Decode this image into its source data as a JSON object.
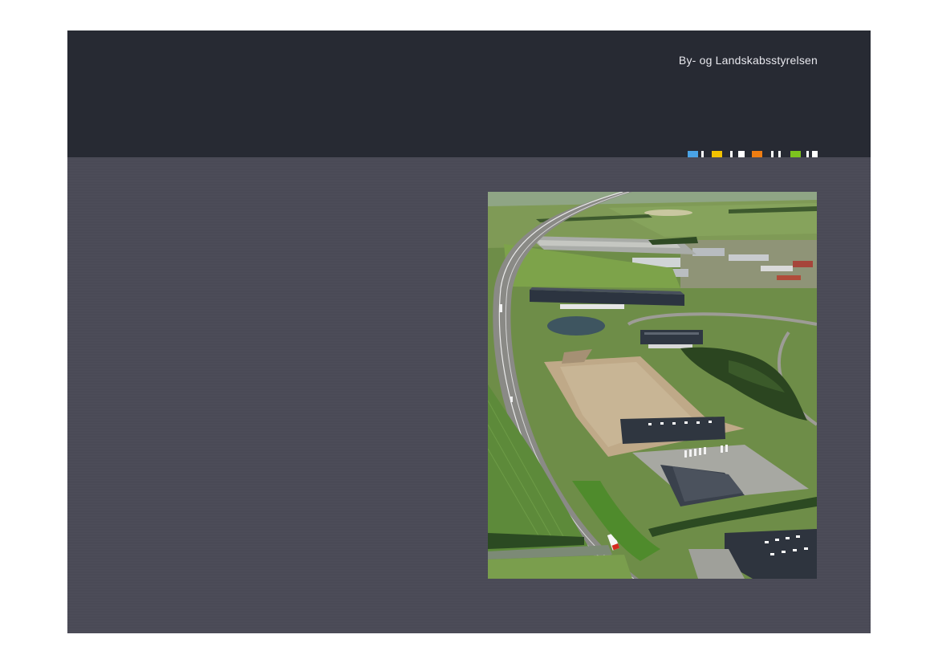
{
  "header": {
    "agency_name": "By- og Landskabsstyrelsen"
  },
  "logo": {
    "name": "agency-logo-stripe",
    "segments": [
      {
        "color": "#4aa3e6"
      },
      {
        "color": "#ffffff"
      },
      {
        "color": "#f2c200"
      },
      {
        "color": "#ffffff"
      },
      {
        "color": "#ffffff"
      },
      {
        "color": "#ef7d12"
      },
      {
        "color": "#ffffff"
      },
      {
        "color": "#ffffff"
      },
      {
        "color": "#7cc31e"
      },
      {
        "color": "#ffffff"
      },
      {
        "color": "#ffffff"
      }
    ]
  },
  "colors": {
    "header_band": "#272a33",
    "body_panel": "#4a4a57",
    "page_background": "#ffffff"
  },
  "photo": {
    "name": "aerial-photo-industrial-area-highway"
  }
}
